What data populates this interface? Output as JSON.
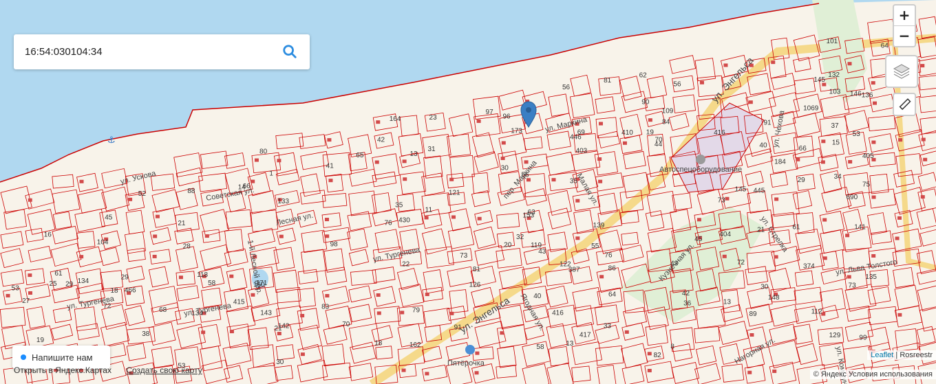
{
  "search": {
    "value": "16:54:030104:34",
    "icon": "search-icon"
  },
  "controls": {
    "zoom_in": "+",
    "zoom_out": "−",
    "layers_icon": "layers-icon",
    "ruler_icon": "ruler-icon"
  },
  "chat": {
    "label": "Напишите нам"
  },
  "footer": {
    "yandex_text": "Открыть в Яндекс.Картах",
    "create_map": "Создать свою карту"
  },
  "attribution": {
    "leaflet": "Leaflet",
    "separator": "|",
    "rosreestr": "Rosreestr"
  },
  "copyright": "© Яндекс Условия использования",
  "streets": {
    "engelsa_main": "ул. Энгельса",
    "engelsa_upper": "ул. Энгельса",
    "sovetskaya": "Советская ул.",
    "lesnaya": "Лесная ул.",
    "turgeneva_1": "ул. Тургенева",
    "turgeneva_2": "ул. Тургенева",
    "markina": "ул. Маркина",
    "turgeneva_3": "ул. Тургенева",
    "chekhova": "ул. Чехова",
    "strelka": "ул. Стрелка",
    "lva_tolstogo": "ул. Льва Толстого",
    "kuznechnaya": "Кузнечная ул.",
    "yagodnaya": "Ягодная ул.",
    "malaya": "Малая ул.",
    "uskova": "ул. Ускова",
    "lesnoy_per": "1-й Лесной пер.",
    "per_markina": "пер. Маркина",
    "nagornaya": "Нагорная ул.",
    "kommunarov": "ул. Коммунаров"
  },
  "pois": {
    "avtospec": "Автоспецоборудование",
    "pyaterochka": "Пятёрочка"
  },
  "parcel_labels": [
    "417",
    "58",
    "416",
    "416",
    "690",
    "1",
    "430",
    "415",
    "18",
    "35",
    "119",
    "44",
    "45",
    "40",
    "42",
    "43",
    "21",
    "36",
    "35",
    "109",
    "88",
    "91",
    "86",
    "62",
    "83",
    "79",
    "75",
    "76",
    "56",
    "64",
    "30",
    "21",
    "20",
    "22",
    "63",
    "101",
    "98",
    "97",
    "80",
    "90",
    "99",
    "89",
    "42",
    "30",
    "29",
    "13",
    "19",
    "52",
    "38",
    "40",
    "64",
    "65",
    "66",
    "69",
    "68",
    "70",
    "72",
    "73",
    "118",
    "410",
    "134",
    "81",
    "126",
    "132",
    "139",
    "145",
    "136",
    "153",
    "374",
    "135",
    "115",
    "112",
    "84",
    "82",
    "96",
    "103",
    "104",
    "121",
    "164",
    "387",
    "162",
    "403",
    "404",
    "73",
    "405",
    "13",
    "66",
    "61",
    "58",
    "56",
    "73",
    "70",
    "76",
    "53",
    "60",
    "61",
    "55",
    "56",
    "53",
    "445",
    "446",
    "466",
    "37",
    "11",
    "41",
    "18",
    "28",
    "29",
    "31",
    "23",
    "72",
    "81",
    "21",
    "1069",
    "33",
    "16",
    "15",
    "14",
    "53",
    "171",
    "145",
    "133",
    "184",
    "141",
    "142",
    "143",
    "129",
    "122",
    "32",
    "173",
    "134",
    "146",
    "148",
    "150",
    "13",
    "45",
    "43",
    "25",
    "29",
    "27",
    "8",
    "91",
    "34",
    "30",
    "19"
  ]
}
